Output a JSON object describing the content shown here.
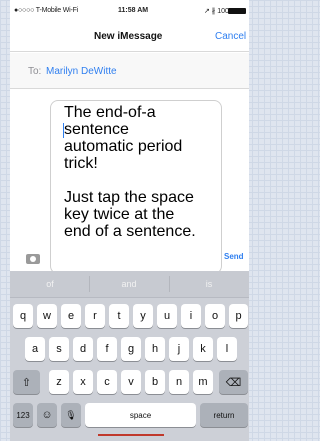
{
  "status_bar": {
    "carrier": "●○○○○ T-Mobile Wi-Fi",
    "time": "11:58 AM",
    "right_status": "↗ ∦ 100%"
  },
  "nav": {
    "title": "New iMessage",
    "cancel": "Cancel"
  },
  "to_field": {
    "label": "To:",
    "recipient": "Marilyn DeWitte"
  },
  "message": {
    "text": "The end-of-a\nsentence\nautomatic period\ntrick!\n\nJust tap the space\nkey twice at the\nend of a sentence.",
    "send": "Send"
  },
  "keyboard": {
    "suggestions": [
      "of",
      "and",
      "is"
    ],
    "row1": [
      "q",
      "w",
      "e",
      "r",
      "t",
      "y",
      "u",
      "i",
      "o",
      "p"
    ],
    "row2": [
      "a",
      "s",
      "d",
      "f",
      "g",
      "h",
      "j",
      "k",
      "l"
    ],
    "row3": [
      "z",
      "x",
      "c",
      "v",
      "b",
      "n",
      "m"
    ],
    "shift": "⇧",
    "delete": "⌫",
    "numbers": "123",
    "emoji": "☺",
    "mic": "🎙",
    "space": "space",
    "return": "return"
  }
}
